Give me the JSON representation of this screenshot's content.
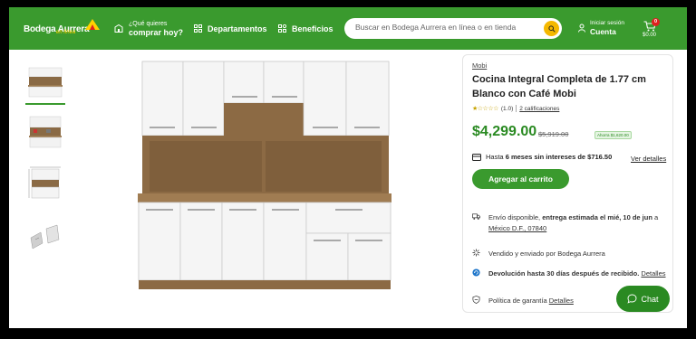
{
  "header": {
    "logo_text": "Bodega Aurrera",
    "logo_sub": "en línea",
    "store_line1": "¿Qué quieres",
    "store_line2": "comprar hoy?",
    "departments": "Departamentos",
    "benefits": "Beneficios",
    "search_placeholder": "Buscar en Bodega Aurrera en línea o en tienda",
    "account_line1": "Iniciar sesión",
    "account_line2": "Cuenta",
    "cart_count": "0",
    "cart_total": "$0.00"
  },
  "product": {
    "brand": "Mobi",
    "title": "Cocina Integral Completa de 1.77 cm Blanco con Café Mobi",
    "rating_value": "(1.0)",
    "rating_count": "2 calificaciones",
    "price": "$4,299.00",
    "old_price": "$5,919.00",
    "savings": "Ahorra $1,620.00",
    "installments_pre": "Hasta ",
    "installments_bold": "6 meses sin intereses de $716.50",
    "installments_link": "Ver detalles",
    "add_to_cart": "Agregar al carrito",
    "shipping_pre": "Envío disponible, ",
    "shipping_bold": "entrega estimada el mié, 10 de jun",
    "shipping_post": " a",
    "shipping_location": "México D.F., 07840",
    "sold_by": "Vendido y enviado por Bodega Aurrera",
    "returns": "Devolución hasta 30 días después de recibido.",
    "returns_link": "Detalles",
    "warranty": "Política de garantía",
    "warranty_link": "Detalles"
  },
  "chat_label": "Chat",
  "colors": {
    "brand_green": "#3a9a2e",
    "price_green": "#2a8a22",
    "search_yellow": "#f5b800"
  }
}
